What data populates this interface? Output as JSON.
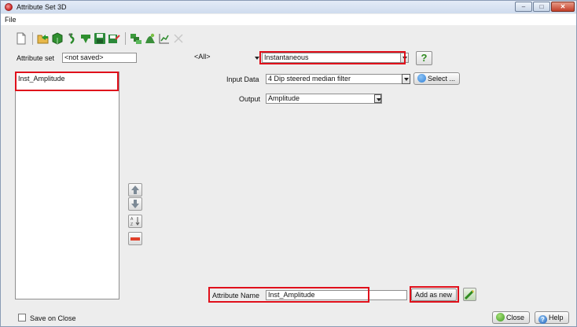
{
  "window": {
    "title": "Attribute Set 3D",
    "controls": [
      "minimize",
      "maximize",
      "close"
    ]
  },
  "menu": {
    "file": "File"
  },
  "toolbar": {
    "icons": [
      "new-set-icon",
      "open-set-icon",
      "default-set-icon",
      "import-icon",
      "import-file-icon",
      "save-icon",
      "save-as-icon",
      "evaluate-icon",
      "crossplot-icon",
      "graph-icon",
      "disabled-icon"
    ]
  },
  "attribute_set": {
    "label": "Attribute set",
    "value": "<not saved>"
  },
  "filter": {
    "value": "<All>"
  },
  "attribute_type": {
    "value": "Instantaneous"
  },
  "help_button": {
    "label": "?"
  },
  "attributes_list": {
    "items": [
      "Inst_Amplitude"
    ]
  },
  "input_data": {
    "label": "Input Data",
    "value": "4 Dip steered median filter",
    "select_label": "Select ..."
  },
  "output": {
    "label": "Output",
    "value": "Amplitude"
  },
  "attribute_name": {
    "label": "Attribute Name",
    "value": "Inst_Amplitude"
  },
  "add_as_new": {
    "label": "Add as new"
  },
  "footer": {
    "save_on_close": "Save on Close",
    "save_on_close_checked": false,
    "close_label": "Close",
    "help_label": "Help"
  },
  "colors": {
    "highlight": "#e0101b",
    "accent_green": "#2e8b1f",
    "select_blue": "#2f7fd8"
  }
}
